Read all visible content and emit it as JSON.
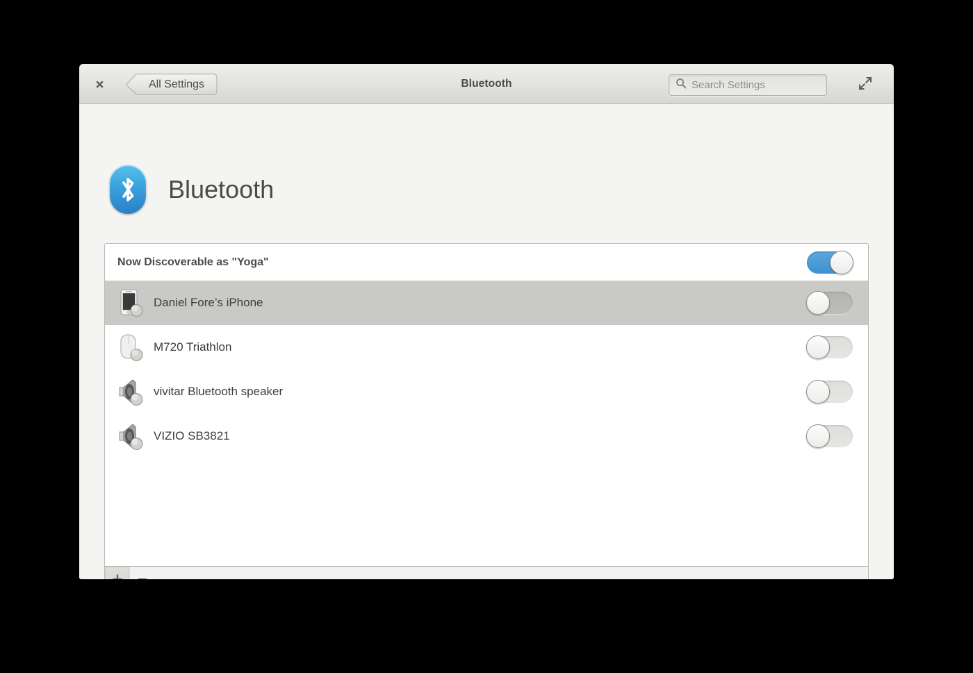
{
  "window": {
    "title": "Bluetooth",
    "close_icon": "close-icon",
    "maximize_icon": "maximize-icon",
    "back_button_label": "All Settings"
  },
  "search": {
    "placeholder": "Search Settings",
    "value": "",
    "icon": "search-icon"
  },
  "page": {
    "heading": "Bluetooth",
    "app_icon": "bluetooth-icon"
  },
  "discoverable": {
    "label": "Now Discoverable as \"Yoga\"",
    "enabled": true
  },
  "devices": [
    {
      "name": "Daniel Fore’s iPhone",
      "icon": "phone-icon",
      "paired": false,
      "selected": true
    },
    {
      "name": "M720 Triathlon",
      "icon": "mouse-icon",
      "paired": false,
      "selected": false
    },
    {
      "name": "vivitar Bluetooth speaker",
      "icon": "speaker-icon",
      "paired": false,
      "selected": false
    },
    {
      "name": "VIZIO SB3821",
      "icon": "speaker-icon",
      "paired": false,
      "selected": false
    }
  ],
  "toolbar": {
    "add_label": "+",
    "remove_label": "−"
  },
  "colors": {
    "accent": "#3e91cf",
    "window_bg": "#f4f4f2",
    "titlebar_top": "#eeeeec",
    "titlebar_bottom": "#d6d6d3",
    "selected_row": "#c9c9c6",
    "text": "#3c3c38"
  }
}
